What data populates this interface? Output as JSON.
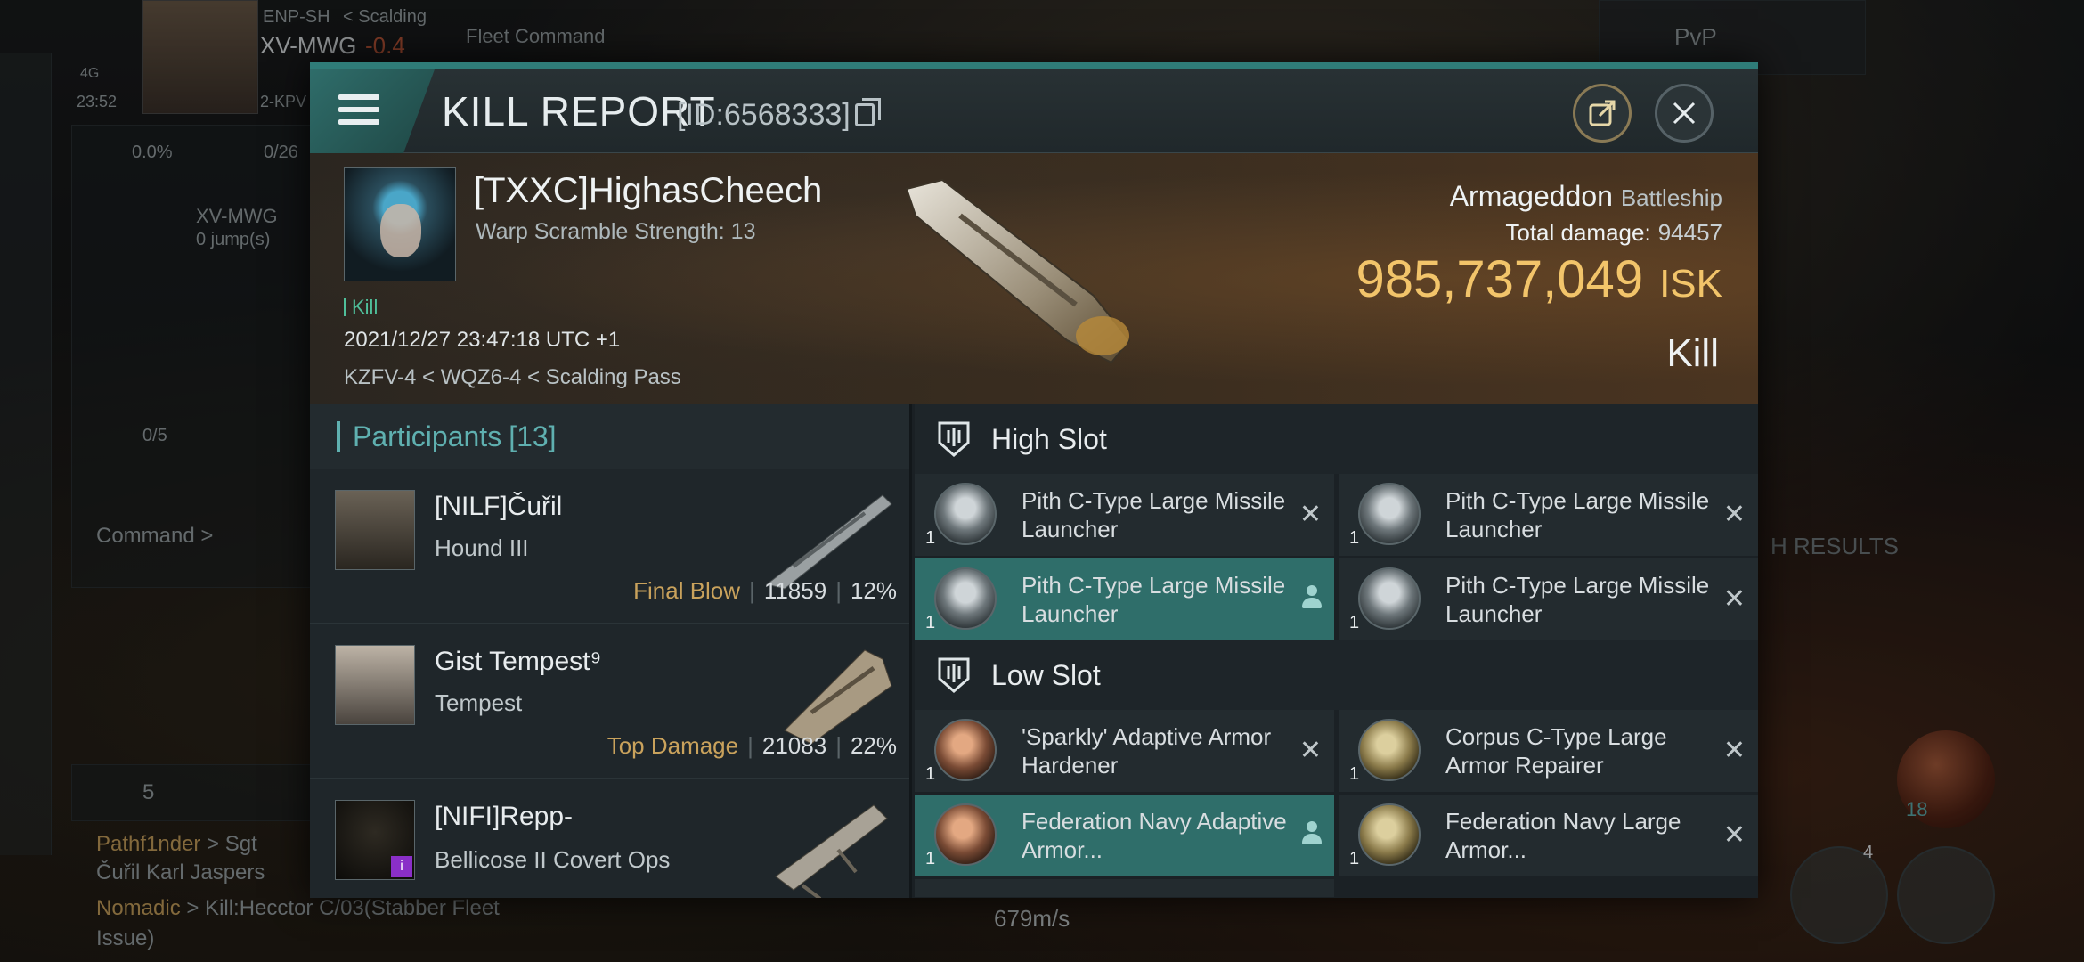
{
  "hud": {
    "corp_tag": "ENP-SH",
    "location": "< Scalding",
    "system": "XV-MWG",
    "security": "-0.4",
    "fleet_command": "Fleet Command",
    "time": "23:52",
    "network": "4G",
    "region_tag": "2-KPV",
    "stat1": "0.0%",
    "stat2": "0/26",
    "nav_target": "XV-MWG",
    "nav_jumps": "0 jump(s)",
    "slot_count": "0/5",
    "command": "Command >",
    "pvp_label": "PvP",
    "member_count": "5",
    "chat_line1_name": "Pathf1nder",
    "chat_line1_rest": " > Sgt",
    "chat_line2": "Čuřil  Karl Jaspers",
    "chat_line3_name": "Nomadic",
    "chat_line3_rest": " > Kill:Hecctor C/03(Stabber Fleet",
    "chat_line4": "Issue)",
    "speed": "679m/s",
    "search_results": "H RESULTS",
    "badge_count": "18",
    "ship_btn_count": "4"
  },
  "report": {
    "title": "KILL REPORT",
    "id_text": "[ID:6568333]",
    "victim": {
      "name": "[TXXC]HighasCheech",
      "scramble": "Warp Scramble Strength: 13",
      "tag": "Kill",
      "datetime": "2021/12/27 23:47:18 UTC +1",
      "location": "KZFV-4 < WQZ6-4 < Scalding Pass",
      "ship": "Armageddon",
      "ship_class": "Battleship",
      "damage_label": "Total damage:",
      "damage_value": "94457",
      "isk_value": "985,737,049",
      "isk_unit": "ISK",
      "result": "Kill"
    },
    "participants": {
      "label": "Participants",
      "count": "[13]",
      "rows": [
        {
          "name": "[NILF]Čuřil",
          "ship": "Hound III",
          "role": "Final Blow",
          "damage": "11859",
          "percent": "12%"
        },
        {
          "name": "Gist Tempest⁹",
          "ship": "Tempest",
          "role": "Top Damage",
          "damage": "21083",
          "percent": "22%"
        },
        {
          "name": "[NIFI]Repp-",
          "ship": "Bellicose II Covert Ops",
          "role": "",
          "damage": "",
          "percent": ""
        }
      ]
    },
    "high_slot": {
      "label": "High Slot",
      "items": [
        {
          "name": "Pith C-Type Large Missile Launcher",
          "qty": "1"
        },
        {
          "name": "Pith C-Type Large Missile Launcher",
          "qty": "1"
        },
        {
          "name": "Pith C-Type Large Missile Launcher",
          "qty": "1"
        },
        {
          "name": "Pith C-Type Large Missile Launcher",
          "qty": "1"
        }
      ]
    },
    "low_slot": {
      "label": "Low Slot",
      "items": [
        {
          "name": "'Sparkly' Adaptive Armor Hardener",
          "qty": "1"
        },
        {
          "name": "Corpus C-Type Large Armor Repairer",
          "qty": "1"
        },
        {
          "name": "Federation Navy Adaptive Armor...",
          "qty": "1"
        },
        {
          "name": "Federation Navy Large Armor...",
          "qty": "1"
        }
      ]
    }
  }
}
